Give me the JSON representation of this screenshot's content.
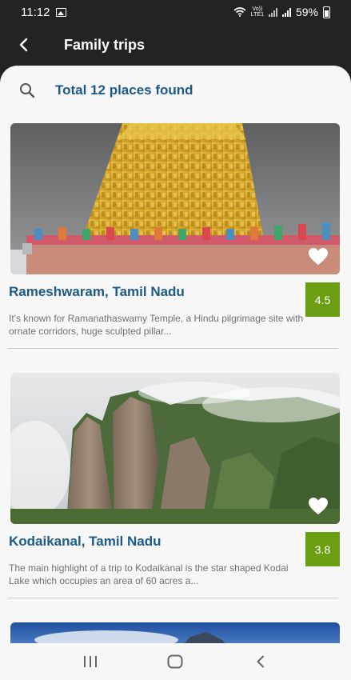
{
  "status_bar": {
    "time": "11:12",
    "volte": "Vo))",
    "lte": "LTE1",
    "battery": "59%"
  },
  "header": {
    "title": "Family trips",
    "back_icon": "arrow-left-icon"
  },
  "search": {
    "icon": "search-icon",
    "result_text": "Total 12 places found"
  },
  "places": [
    {
      "name": "Rameshwaram, Tamil Nadu",
      "rating": "4.5",
      "description": "It's known for Ramanathaswamy Temple, a Hindu pilgrimage site with ornate corridors, huge sculpted pillar...",
      "favorite_icon": "heart-icon"
    },
    {
      "name": "Kodaikanal, Tamil Nadu",
      "rating": "3.8",
      "description": "The main highlight of a trip to Kodaikanal is the star shaped Kodai Lake which occupies an area of 60 acres a...",
      "favorite_icon": "heart-icon"
    }
  ],
  "colors": {
    "accent_blue": "#1d5a8a",
    "rating_green": "#6b9e12",
    "header_bg": "#232323"
  },
  "nav_bar": {
    "recents": "recent-apps-icon",
    "home": "home-icon",
    "back": "back-icon"
  }
}
